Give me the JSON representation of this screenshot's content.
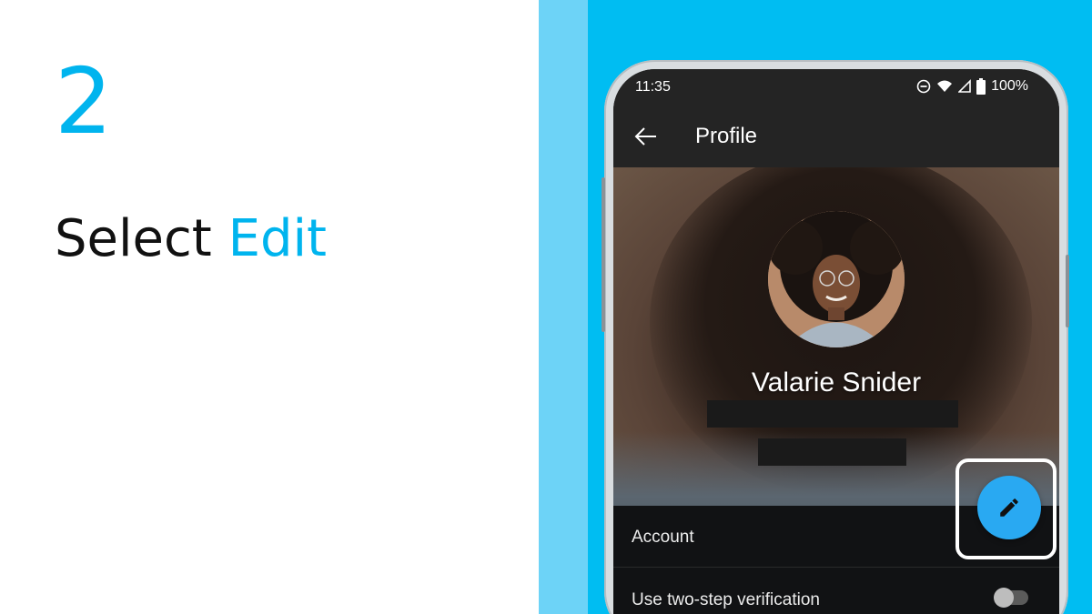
{
  "instruction": {
    "step_number": "2",
    "title_prefix": "Select ",
    "title_highlight": "Edit"
  },
  "colors": {
    "accent": "#00b4ee",
    "backdrop": "#00bdf2",
    "fab": "#29a9f2"
  },
  "status_bar": {
    "time": "11:35",
    "battery": "100%",
    "icons": [
      "do-not-disturb-icon",
      "wifi-icon",
      "signal-icon",
      "battery-icon"
    ]
  },
  "app_bar": {
    "title": "Profile",
    "back_icon": "arrow-left-icon"
  },
  "profile": {
    "name": "Valarie Snider"
  },
  "rows": {
    "account_label": "Account",
    "two_step_label": "Use two-step verification",
    "two_step_enabled": false
  },
  "fab": {
    "icon": "pencil-icon"
  }
}
